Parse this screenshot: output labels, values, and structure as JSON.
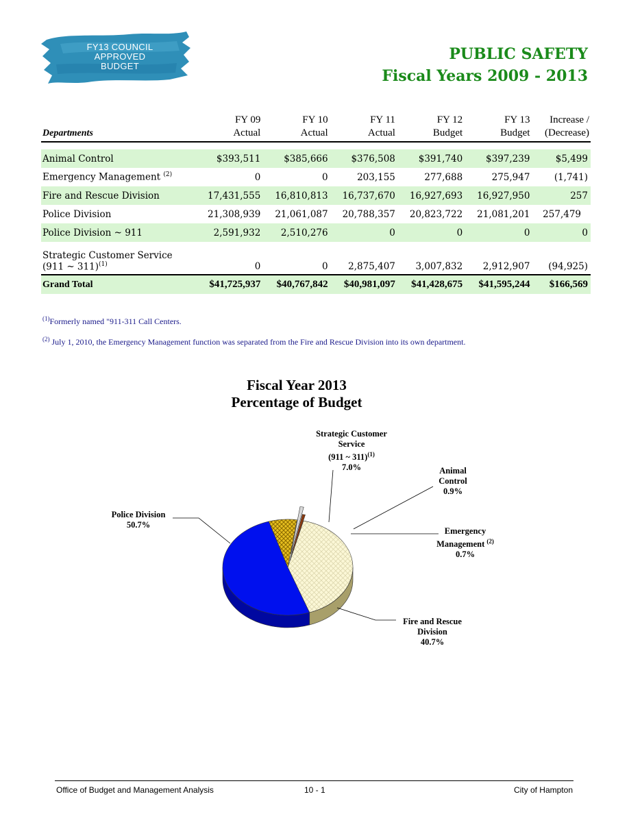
{
  "header": {
    "badge_lines": [
      "FY13 COUNCIL",
      "APPROVED",
      "BUDGET"
    ],
    "title": "PUBLIC SAFETY",
    "subtitle": "Fiscal Years 2009 - 2013"
  },
  "table": {
    "headers": {
      "dept": "Departments",
      "fy09_1": "FY 09",
      "fy09_2": "Actual",
      "fy10_1": "FY 10",
      "fy10_2": "Actual",
      "fy11_1": "FY 11",
      "fy11_2": "Actual",
      "fy12_1": "FY 12",
      "fy12_2": "Budget",
      "fy13_1": "FY 13",
      "fy13_2": "Budget",
      "inc_1": "Increase /",
      "inc_2": "(Decrease)"
    },
    "rows": [
      {
        "name": "Animal Control",
        "fy09": "$393,511",
        "fy10": "$385,666",
        "fy11": "$376,508",
        "fy12": "$391,740",
        "fy13": "$397,239",
        "inc": "$5,499"
      },
      {
        "name": "Emergency Management",
        "note": "(2)",
        "fy09": "0",
        "fy10": "0",
        "fy11": "203,155",
        "fy12": "277,688",
        "fy13": "275,947",
        "inc": "(1,741)"
      },
      {
        "name": "Fire and Rescue Division",
        "fy09": "17,431,555",
        "fy10": "16,810,813",
        "fy11": "16,737,670",
        "fy12": "16,927,693",
        "fy13": "16,927,950",
        "inc": "257"
      },
      {
        "name": "Police Division",
        "fy09": "21,308,939",
        "fy10": "21,061,087",
        "fy11": "20,788,357",
        "fy12": "20,823,722",
        "fy13": "21,081,201",
        "inc": "257,479"
      },
      {
        "name": "Police Division ~ 911",
        "fy09": "2,591,932",
        "fy10": "2,510,276",
        "fy11": "0",
        "fy12": "0",
        "fy13": "0",
        "inc": "0"
      },
      {
        "name_line1": "Strategic Customer Service",
        "name_line2": "(911 ~ 311)",
        "note": "(1)",
        "fy09": "0",
        "fy10": "0",
        "fy11": "2,875,407",
        "fy12": "3,007,832",
        "fy13": "2,912,907",
        "inc": "(94,925)"
      }
    ],
    "total": {
      "name": "Grand Total",
      "fy09": "$41,725,937",
      "fy10": "$40,767,842",
      "fy11": "$40,981,097",
      "fy12": "$41,428,675",
      "fy13": "$41,595,244",
      "inc": "$166,569"
    }
  },
  "footnotes": {
    "fn1_mark": "(1)",
    "fn1": "Formerly named \"911-311 Call Centers.",
    "fn2_mark": "(2)",
    "fn2": " July 1, 2010, the Emergency Management function was separated from the Fire and Rescue Division into its own department."
  },
  "chart_data": {
    "type": "pie",
    "title_line1": "Fiscal Year 2013",
    "title_line2": "Percentage of Budget",
    "slices": [
      {
        "label": "Strategic Customer Service (911 ~ 311)",
        "value": 7.0,
        "color": "#e8c020"
      },
      {
        "label": "Animal Control",
        "value": 0.9,
        "color": "#d8d8d8"
      },
      {
        "label": "Emergency Management",
        "value": 0.7,
        "color": "#8a3a10"
      },
      {
        "label": "Fire and Rescue Division",
        "value": 40.7,
        "color": "#fbf7d6"
      },
      {
        "label": "Police Division",
        "value": 50.7,
        "color": "#0010ee"
      }
    ],
    "labels": {
      "scs_1": "Strategic Customer",
      "scs_2": "Service",
      "scs_3": "(911 ~ 311)",
      "scs_note": "(1)",
      "scs_pct": "7.0%",
      "ac_1": "Animal",
      "ac_2": "Control",
      "ac_pct": "0.9%",
      "em_1": "Emergency",
      "em_2": "Management",
      "em_note": "(2)",
      "em_pct": "0.7%",
      "fr_1": "Fire and Rescue",
      "fr_2": "Division",
      "fr_pct": "40.7%",
      "pd_1": "Police Division",
      "pd_pct": "50.7%"
    }
  },
  "footer": {
    "left": "Office of Budget and Management  Analysis",
    "center": "10 - 1",
    "right": "City of Hampton"
  }
}
